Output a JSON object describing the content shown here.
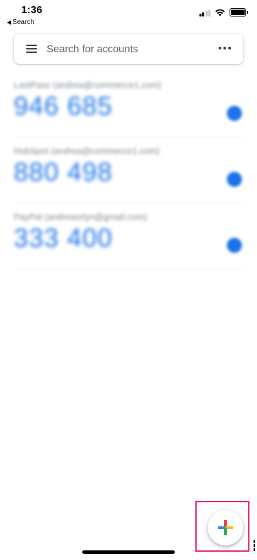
{
  "status_bar": {
    "time": "1:36",
    "back_app": "Search",
    "back_caret": "◀"
  },
  "search": {
    "placeholder": "Search for accounts"
  },
  "accounts": [
    {
      "label": "LastPass (andrea@commerce1.com)",
      "code": "946 685",
      "icon": "timer-icon"
    },
    {
      "label": "HubSpot (andrea@commerce1.com)",
      "code": "880 498",
      "icon": "timer-icon"
    },
    {
      "label": "PayPal (andreaorlyn@gmail.com)",
      "code": "333 400",
      "icon": "timer-icon"
    }
  ],
  "fab": {
    "icon": "plus-icon"
  },
  "colors": {
    "code_blue": "#1a73e8",
    "highlight": "#e8287d",
    "plus_red": "#ea4335",
    "plus_blue": "#4285f4",
    "plus_yellow": "#fbbc05",
    "plus_green": "#34a853"
  }
}
